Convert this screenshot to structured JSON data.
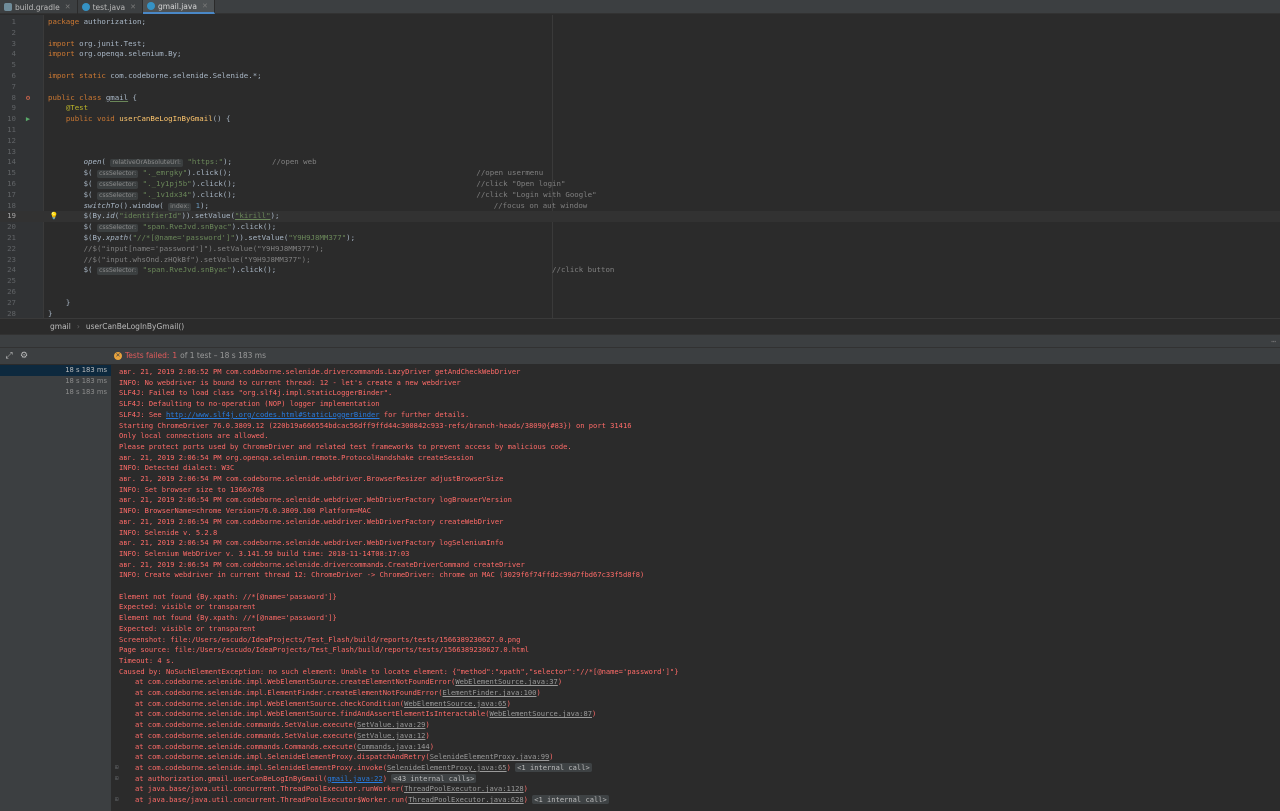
{
  "tabs": [
    {
      "label": "build.gradle",
      "icon": "gradle-file-icon"
    },
    {
      "label": "test.java",
      "icon": "java-file-icon"
    },
    {
      "label": "gmail.java",
      "icon": "java-file-icon",
      "active": true
    }
  ],
  "editor": {
    "line_numbers": [
      "1",
      "2",
      "3",
      "4",
      "5",
      "6",
      "7",
      "8",
      "9",
      "10",
      "11",
      "12",
      "13",
      "14",
      "15",
      "16",
      "17",
      "18",
      "19",
      "20",
      "21",
      "22",
      "23",
      "24",
      "25",
      "26",
      "27",
      "28"
    ],
    "code": {
      "l1_kw": "package",
      "l1_rest": " authorization;",
      "l3_kw": "import",
      "l3_rest": " org.junit.Test;",
      "l4_kw": "import",
      "l4_rest": " org.openqa.selenium.By;",
      "l6_kw": "import static",
      "l6_rest": " com.codeborne.selenide.Selenide.*;",
      "l8_kw": "public class ",
      "l8_name": "gmail",
      "l8_rest": " {",
      "l9_ann": "@Test",
      "l10_kw": "public void ",
      "l10_fn": "userCanBeLogInByGmail",
      "l10_rest": "() {",
      "l14_fn": "open",
      "l14_hint": "relativeOrAbsoluteUrl:",
      "l14_str": "\"https:\"",
      "l14_rest": ");",
      "l14_cmt": "//open web",
      "l15_pre": "$(",
      "l15_hint": "cssSelector:",
      "l15_str": "\"._emrgky\"",
      "l15_rest": ").click();",
      "l15_cmt": "//open usermenu",
      "l16_pre": "$(",
      "l16_hint": "cssSelector:",
      "l16_str": "\"._1y1pj5b\"",
      "l16_rest": ").click();",
      "l16_cmt": "//click \"Open login\"",
      "l17_pre": "$(",
      "l17_hint": "cssSelector:",
      "l17_str": "\"._1v1dx34\"",
      "l17_rest": ").click();",
      "l17_cmt": "//click \"Login with Google\"",
      "l18_fn": "switchTo",
      "l18_mid": "().window(",
      "l18_hint": "index:",
      "l18_num": "1",
      "l18_rest": ");",
      "l18_cmt": "//focus on aut window",
      "l19_pre": "$(By.",
      "l19_fn": "id",
      "l19_a": "(",
      "l19_str1": "\"identifierId\"",
      "l19_b": ")).setValue(",
      "l19_str2": "\"kirill\"",
      "l19_rest": ");",
      "l20_pre": "$(",
      "l20_hint": "cssSelector:",
      "l20_str": "\"span.RveJvd.snByac\"",
      "l20_rest": ").click();",
      "l21_pre": "$(By.",
      "l21_fn": "xpath",
      "l21_a": "(",
      "l21_str1": "\"//*[@name='password']\"",
      "l21_b": ")).setValue(",
      "l21_str2": "\"Y9H9J8MM377\"",
      "l21_rest": ");",
      "l22_cmt": "//$(\"input[name='password']\").setValue(\"Y9H9J8MM377\");",
      "l23_cmt": "//$(\"input.whsOnd.zHQkBf\").setValue(\"Y9H9J8MM377\");",
      "l24_pre": "$(",
      "l24_hint": "cssSelector:",
      "l24_str": "\"span.RveJvd.snByac\"",
      "l24_rest": ").click();",
      "l24_cmt": "//click button",
      "l27": "}",
      "l28": "}"
    }
  },
  "breadcrumb": {
    "class": "gmail",
    "method": "userCanBeLogInByGmail()"
  },
  "run": {
    "status_label": "Tests failed:",
    "status_count": "1",
    "status_rest": "of 1 test – 18 s 183 ms",
    "tree": [
      "18 s 183 ms",
      "18 s 183 ms",
      "18 s 183 ms"
    ]
  },
  "console": {
    "lines": [
      "авг. 21, 2019 2:06:52 PM com.codeborne.selenide.drivercommands.LazyDriver getAndCheckWebDriver",
      "INFO: No webdriver is bound to current thread: 12 - let's create a new webdriver",
      "SLF4J: Failed to load class \"org.slf4j.impl.StaticLoggerBinder\".",
      "SLF4J: Defaulting to no-operation (NOP) logger implementation",
      "SLF4J: See ",
      "Starting ChromeDriver 76.0.3809.12 (220b19a666554bdcac56dff9ffd44c300842c933-refs/branch-heads/3809@{#83}) on port 31416",
      "Only local connections are allowed.",
      "Please protect ports used by ChromeDriver and related test frameworks to prevent access by malicious code.",
      "авг. 21, 2019 2:06:54 PM org.openqa.selenium.remote.ProtocolHandshake createSession",
      "INFO: Detected dialect: W3C",
      "авг. 21, 2019 2:06:54 PM com.codeborne.selenide.webdriver.BrowserResizer adjustBrowserSize",
      "INFO: Set browser size to 1366x768",
      "авг. 21, 2019 2:06:54 PM com.codeborne.selenide.webdriver.WebDriverFactory logBrowserVersion",
      "INFO: BrowserName=chrome Version=76.0.3809.100 Platform=MAC",
      "авг. 21, 2019 2:06:54 PM com.codeborne.selenide.webdriver.WebDriverFactory createWebDriver",
      "INFO: Selenide v. 5.2.8",
      "авг. 21, 2019 2:06:54 PM com.codeborne.selenide.webdriver.WebDriverFactory logSeleniumInfo",
      "INFO: Selenium WebDriver v. 3.141.59 build time: 2018-11-14T08:17:03",
      "авг. 21, 2019 2:06:54 PM com.codeborne.selenide.drivercommands.CreateDriverCommand createDriver",
      "INFO: Create webdriver in current thread 12: ChromeDriver -> ChromeDriver: chrome on MAC (3029f6f74ffd2c99d7fbd67c33f5d8f8)",
      "",
      "Element not found {By.xpath: //*[@name='password']}",
      "Expected: visible or transparent",
      "Element not found {By.xpath: //*[@name='password']}",
      "Expected: visible or transparent",
      "Screenshot: file:/Users/escudo/IdeaProjects/Test_Flash/build/reports/tests/1566389230627.0.png",
      "Page source: file:/Users/escudo/IdeaProjects/Test_Flash/build/reports/tests/1566389230627.0.html",
      "Timeout: 4 s.",
      "Caused by: NoSuchElementException: no such element: Unable to locate element: {\"method\":\"xpath\",\"selector\":\"//*[@name='password']\"}"
    ],
    "slf4j_link": "http://www.slf4j.org/codes.html#StaticLoggerBinder",
    "slf4j_tail": " for further details.",
    "stack": [
      {
        "text": "at com.codeborne.selenide.impl.WebElementSource.createElementNotFoundError(",
        "ref": "WebElementSource.java:37",
        "tail": ")"
      },
      {
        "text": "at com.codeborne.selenide.impl.ElementFinder.createElementNotFoundError(",
        "ref": "ElementFinder.java:100",
        "tail": ")"
      },
      {
        "text": "at com.codeborne.selenide.impl.WebElementSource.checkCondition(",
        "ref": "WebElementSource.java:65",
        "tail": ")"
      },
      {
        "text": "at com.codeborne.selenide.impl.WebElementSource.findAndAssertElementIsInteractable(",
        "ref": "WebElementSource.java:87",
        "tail": ")"
      },
      {
        "text": "at com.codeborne.selenide.commands.SetValue.execute(",
        "ref": "SetValue.java:29",
        "tail": ")"
      },
      {
        "text": "at com.codeborne.selenide.commands.SetValue.execute(",
        "ref": "SetValue.java:12",
        "tail": ")"
      },
      {
        "text": "at com.codeborne.selenide.commands.Commands.execute(",
        "ref": "Commands.java:144",
        "tail": ")"
      },
      {
        "text": "at com.codeborne.selenide.impl.SelenideElementProxy.dispatchAndRetry(",
        "ref": "SelenideElementProxy.java:99",
        "tail": ")"
      },
      {
        "text": "at com.codeborne.selenide.impl.SelenideElementProxy.invoke(",
        "ref": "SelenideElementProxy.java:65",
        "tail": ")",
        "pill": "<1 internal call>"
      },
      {
        "text": "at authorization.gmail.userCanBeLogInByGmail(",
        "ref": "gmail.java:22",
        "tail": ")",
        "pill": "<43 internal calls>",
        "link": true
      },
      {
        "text": "at java.base/java.util.concurrent.ThreadPoolExecutor.runWorker(",
        "ref": "ThreadPoolExecutor.java:1128",
        "tail": ")"
      },
      {
        "text": "at java.base/java.util.concurrent.ThreadPoolExecutor$Worker.run(",
        "ref": "ThreadPoolExecutor.java:628",
        "tail": ")",
        "pill": "<1 internal call>"
      }
    ]
  }
}
